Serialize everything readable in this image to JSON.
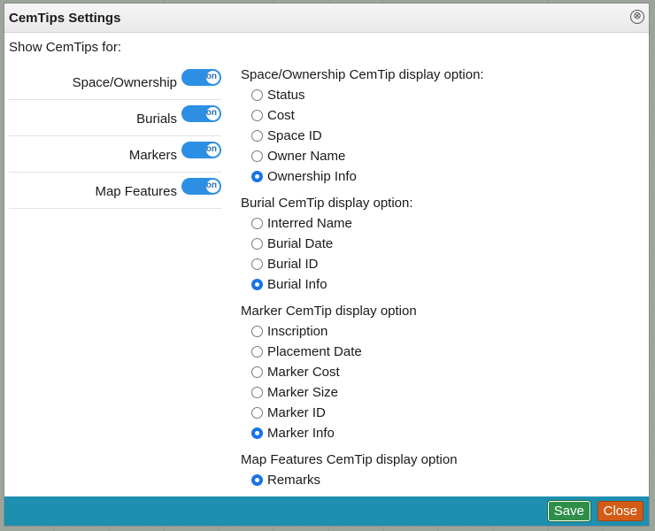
{
  "dialog": {
    "title": "CemTips Settings",
    "close_glyph": "⊗"
  },
  "show_label": "Show CemTips for:",
  "toggles": [
    {
      "label": "Space/Ownership",
      "state": "on"
    },
    {
      "label": "Burials",
      "state": "on"
    },
    {
      "label": "Markers",
      "state": "on"
    },
    {
      "label": "Map Features",
      "state": "on"
    }
  ],
  "groups": [
    {
      "title": "Space/Ownership CemTip display option:",
      "options": [
        "Status",
        "Cost",
        "Space ID",
        "Owner Name",
        "Ownership Info"
      ],
      "selected": 4
    },
    {
      "title": "Burial CemTip display option:",
      "options": [
        "Interred Name",
        "Burial Date",
        "Burial ID",
        "Burial Info"
      ],
      "selected": 3
    },
    {
      "title": "Marker CemTip display option",
      "options": [
        "Inscription",
        "Placement Date",
        "Marker Cost",
        "Marker Size",
        "Marker ID",
        "Marker Info"
      ],
      "selected": 5
    },
    {
      "title": "Map Features CemTip display option",
      "options": [
        "Remarks"
      ],
      "selected": 0
    }
  ],
  "footer": {
    "save_label": "Save",
    "close_label": "Close"
  },
  "colors": {
    "accent": "#1a73e8",
    "toggle": "#2d8fe3",
    "footer": "#1d8fb0",
    "save": "#2f8f4a",
    "close": "#d35c17"
  }
}
